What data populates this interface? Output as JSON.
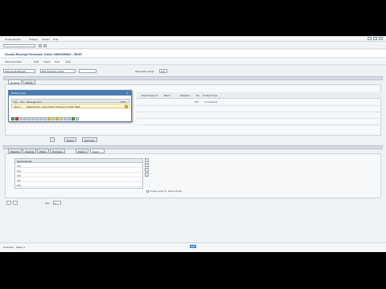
{
  "menubar": {
    "items": [
      "Goods Receipt",
      "Settings",
      "System",
      "Help"
    ]
  },
  "titlebar": {
    "title": "Goods Receipt Purchase Order 4500000962 - BS97"
  },
  "appbar": {
    "buttons": [
      "Show Overview",
      "Hold",
      "Check",
      "Post",
      "Help"
    ]
  },
  "header": {
    "transaction": "A01 Goods Receipt",
    "reference": "R01 Purchase Order",
    "gr_label": "GR goods receipt",
    "gr_value": "101"
  },
  "header_tabs": [
    "General",
    "Vendor"
  ],
  "popup": {
    "title": "Delivery Note",
    "columns": [
      "Typ",
      "Text",
      "Message Text",
      "LTXA"
    ],
    "row": {
      "type": "Inform",
      "text": "Material 101_1 has Online Change no Order 4500"
    }
  },
  "table1": {
    "columns": [
      "Stock Segment",
      "Batch",
      "Valuation",
      "Mv",
      "St Stock Type"
    ],
    "row_values": [
      "101",
      "Unrestricted"
    ]
  },
  "navbar": {
    "labels": [
      "Item",
      "Delete",
      "Summary"
    ]
  },
  "item_tabs": [
    "Material",
    "Quantity",
    "Where",
    "Purchase Order Data",
    "Partner",
    "Serial Numbers"
  ],
  "serial": {
    "header": "Serial Number",
    "rows": [
      "001",
      "002",
      "003",
      "004",
      "005"
    ],
    "checkbox_label": "Create serial no. automatically"
  },
  "lower": {
    "item_label": "Item",
    "item_value": "1"
  },
  "statusbar": {
    "left": "Overview",
    "mid": "Status 1",
    "logo": "SAP"
  }
}
